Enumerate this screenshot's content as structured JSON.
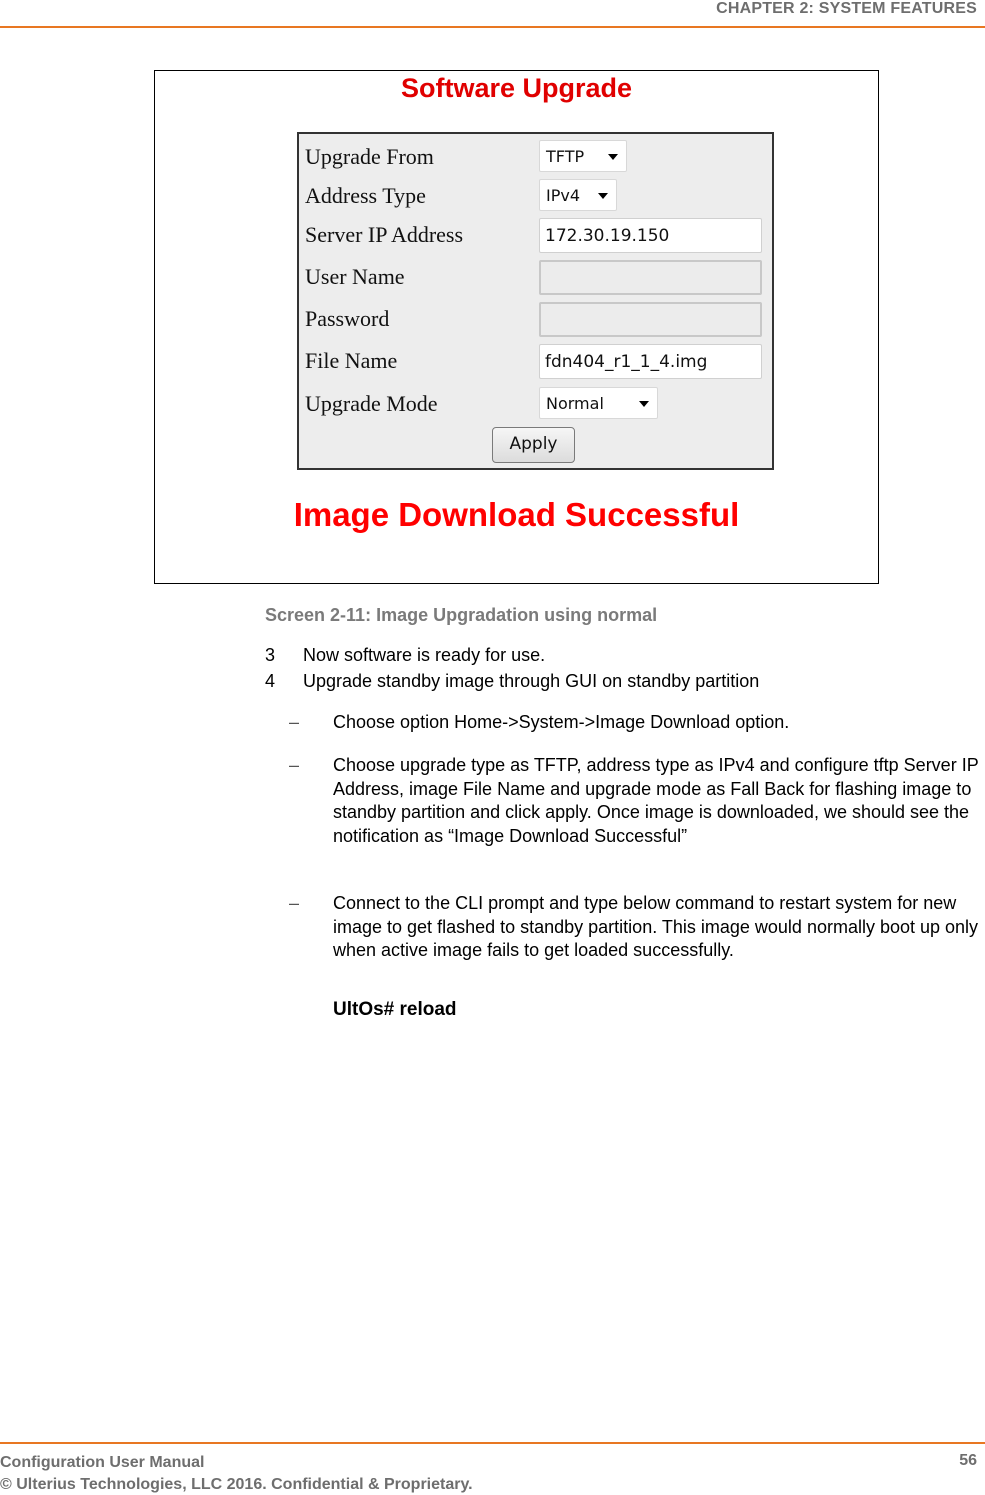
{
  "header": {
    "chapter_title": "CHAPTER 2: SYSTEM FEATURES",
    "accent_color": "#e87722"
  },
  "figure": {
    "title": "Software Upgrade",
    "form": {
      "fields": [
        {
          "label": "Upgrade From",
          "type": "select",
          "value": "TFTP"
        },
        {
          "label": "Address Type",
          "type": "select",
          "value": "IPv4"
        },
        {
          "label": "Server IP Address",
          "type": "text",
          "value": "172.30.19.150"
        },
        {
          "label": "User Name",
          "type": "text",
          "value": "",
          "disabled": true
        },
        {
          "label": "Password",
          "type": "password",
          "value": "",
          "disabled": true
        },
        {
          "label": "File Name",
          "type": "text",
          "value": "fdn404_r1_1_4.img"
        },
        {
          "label": "Upgrade Mode",
          "type": "select",
          "value": "Normal"
        }
      ],
      "apply_label": "Apply"
    },
    "status_message": "Image Download Successful",
    "title_color": "#e00000",
    "status_color": "#ff0000"
  },
  "caption": "Screen 2-11: Image Upgradation using normal",
  "steps": [
    {
      "num": "3",
      "text": "Now software is ready for use."
    },
    {
      "num": "4",
      "text": "Upgrade standby image through GUI on standby partition"
    }
  ],
  "bullets": [
    {
      "dash": "–",
      "text": "Choose option Home->System->Image Download option."
    },
    {
      "dash": "–",
      "text": "Choose upgrade type as TFTP, address type as IPv4 and configure tftp Server IP Address, image File Name and upgrade mode as Fall Back for flashing image to standby partition and click apply. Once image is downloaded, we should see the notification as “Image Download Successful”"
    },
    {
      "dash": "–",
      "text": "Connect to the CLI prompt and type below command to restart system for new image to get flashed to standby partition. This image would normally boot up only when active image fails to get loaded successfully."
    }
  ],
  "command": "UltOs# reload",
  "footer": {
    "manual_title": "Configuration User Manual",
    "copyright": "© Ulterius Technologies, LLC 2016. Confidential & Proprietary.",
    "page_number": "56"
  }
}
